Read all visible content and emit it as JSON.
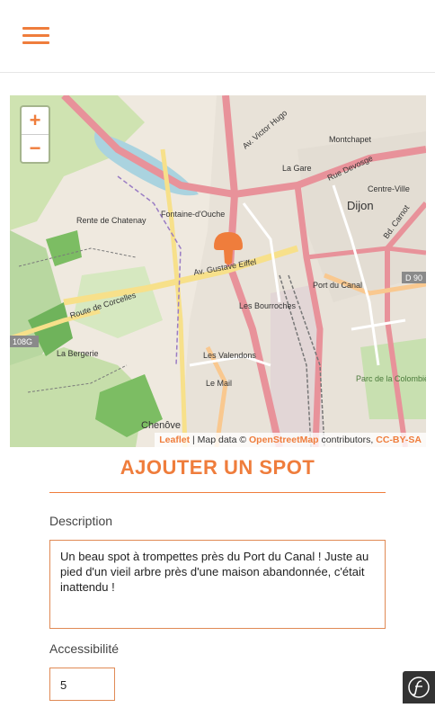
{
  "header": {
    "menu_icon": "hamburger-icon"
  },
  "map": {
    "zoom_in": "+",
    "zoom_out": "−",
    "labels": {
      "dijon": "Dijon",
      "chenove": "Chenôve",
      "la_gare": "La Gare",
      "montchapet": "Montchapet",
      "port_du_canal": "Port du Canal",
      "fontaine": "Fontaine-d'Ouche",
      "bourroches": "Les Bourroches",
      "valendons": "Les Valendons",
      "le_mail": "Le Mail",
      "rente": "Rente de Chatenay",
      "bergerie": "La Bergerie",
      "centre_ville": "Centre-Ville",
      "colombiere": "Parc de la Colombière",
      "av_gustave_eiffel": "Av. Gustave Eiffel",
      "route_corcelles": "Route de Corcelles",
      "rue_devosge": "Rue Devosge",
      "av_victor_hugo": "Av. Victor Hugo",
      "bd_carnot": "Bd. Carnot",
      "badge_108g": "108G",
      "badge_d90": "D 90"
    },
    "attribution": {
      "leaflet": "Leaflet",
      "mid": " | Map data © ",
      "osm": "OpenStreetMap",
      "contrib": " contributors, ",
      "license": "CC-BY-SA"
    },
    "marker_icon": "mushroom-marker-icon"
  },
  "form": {
    "title": "AJOUTER UN SPOT",
    "description_label": "Description",
    "description_value": "Un beau spot à trompettes près du Port du Canal ! Juste au pied d'un vieil arbre près d'une maison abandonnée, c'était inattendu !",
    "accessibility_label": "Accessibilité",
    "accessibility_value": "5"
  },
  "colors": {
    "accent": "#ef7d3c"
  }
}
